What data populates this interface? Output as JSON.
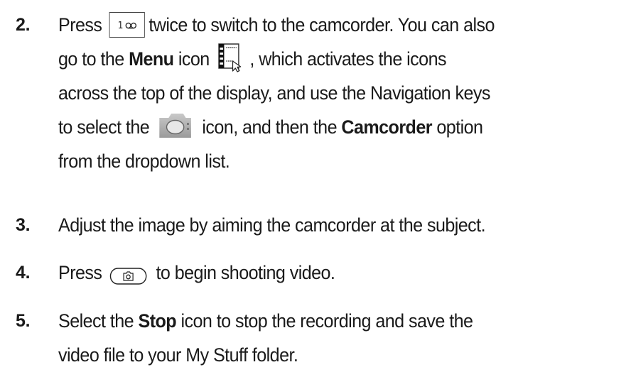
{
  "steps": [
    {
      "number": "2.",
      "lines": [
        [
          "Press ",
          "[key-1]",
          " twice to switch to the camcorder. You can also"
        ],
        [
          "go to the ",
          "Menu",
          " icon ",
          "[menu-icon]",
          " , which activates the icons"
        ],
        [
          "across the top of the display, and use the Navigation keys"
        ],
        [
          "to select the ",
          "[camera-icon]",
          " icon, and then the ",
          "Camcorder",
          " option"
        ],
        [
          "from the dropdown list."
        ]
      ]
    },
    {
      "number": "3.",
      "text": "Adjust the image by aiming the camcorder at the subject."
    },
    {
      "number": "4.",
      "before": "Press",
      "after": "to begin shooting video."
    },
    {
      "number": "5.",
      "line1_before": "Select the ",
      "line1_bold": "Stop",
      "line1_after": " icon to stop the recording and save the",
      "line2": "video file to your My Stuff folder."
    }
  ],
  "icons": {
    "key_1": "key-1-voicemail-icon",
    "menu": "menu-icon",
    "camera": "camera-icon",
    "camera_key": "camera-key-icon"
  },
  "step2": {
    "l1_a": "Press",
    "l1_b": "twice to switch to the camcorder. You can also",
    "l2_a": "go to the ",
    "l2_bold": "Menu",
    "l2_b": " icon",
    "l2_c": ", which activates the icons",
    "l3": "across the top of the display, and use the Navigation keys",
    "l4_a": "to select the",
    "l4_b": "icon, and then the ",
    "l4_bold": "Camcorder",
    "l4_c": " option",
    "l5": "from the dropdown list."
  }
}
